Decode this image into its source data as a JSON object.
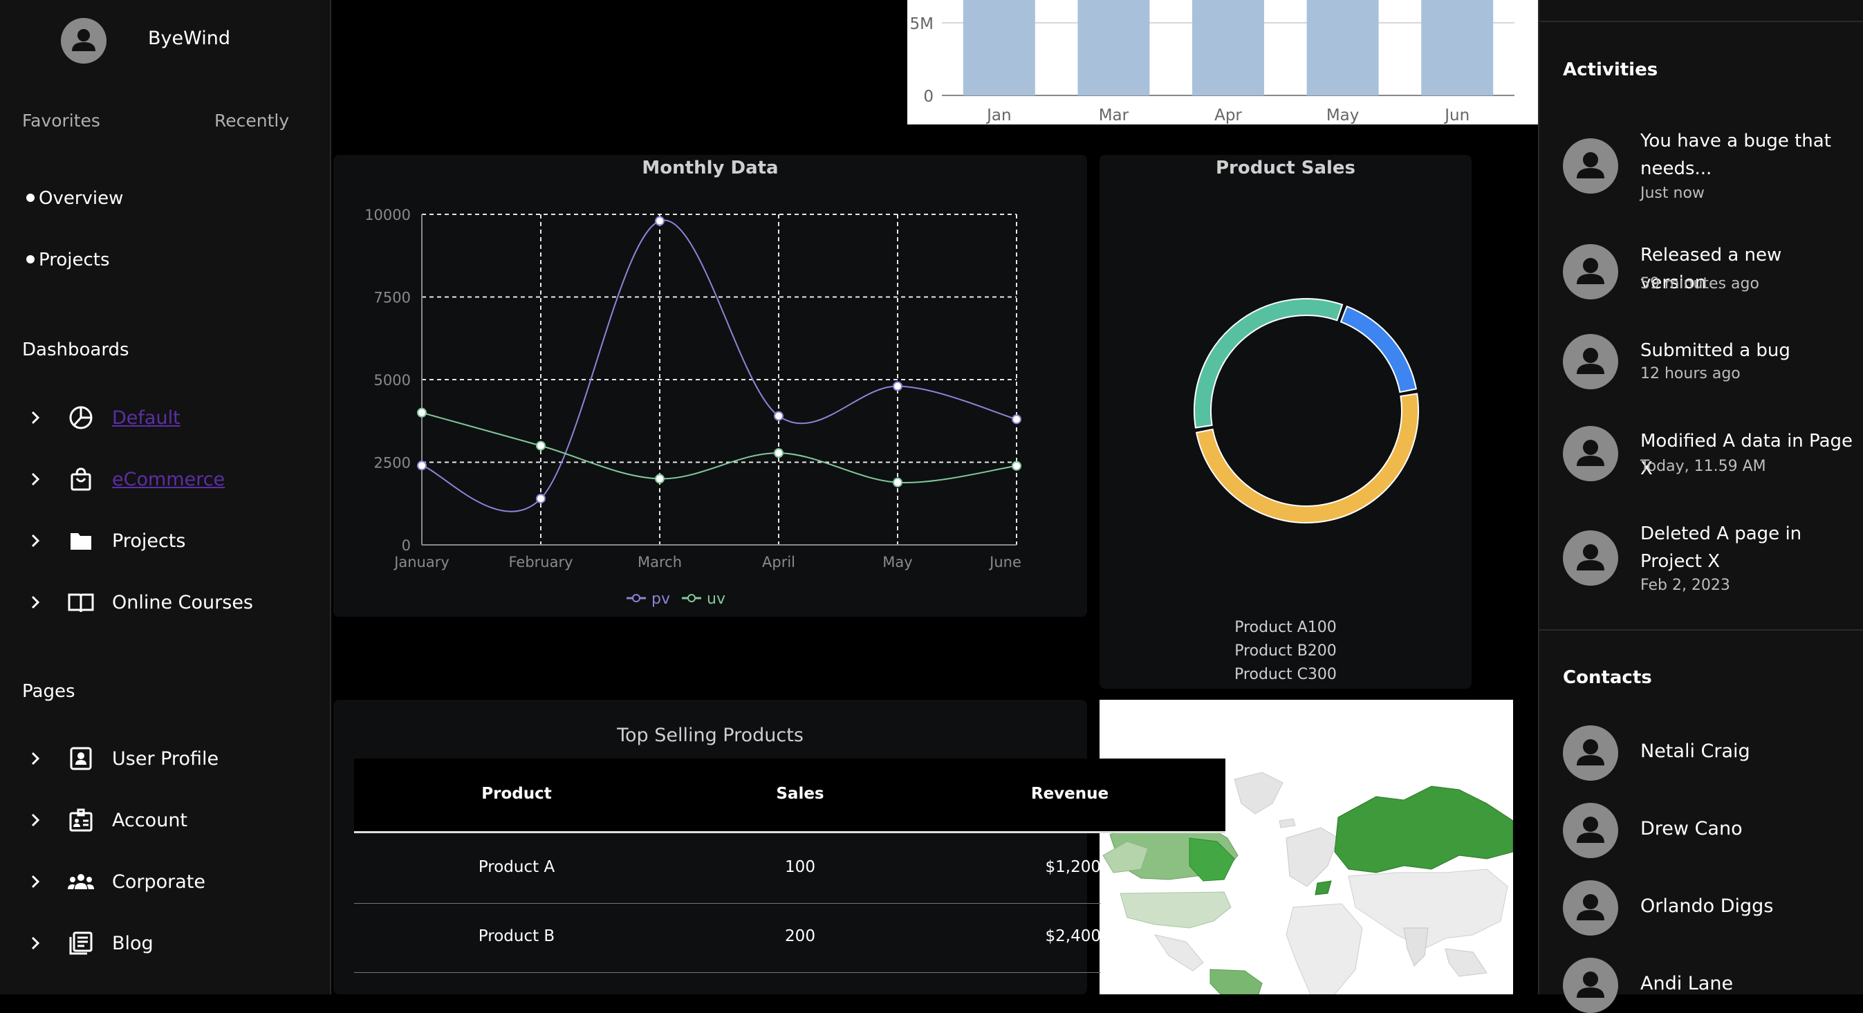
{
  "sidebar": {
    "brand": "ByeWind",
    "tabs": [
      "Favorites",
      "Recently"
    ],
    "quick_items": [
      "Overview",
      "Projects"
    ],
    "dashboards_label": "Dashboards",
    "dashboards": [
      {
        "label": "Default",
        "icon": "pie-chart-icon"
      },
      {
        "label": "eCommerce",
        "icon": "shopping-bag-icon"
      },
      {
        "label": "Projects",
        "icon": "folder-icon"
      },
      {
        "label": "Online Courses",
        "icon": "book-open-icon"
      }
    ],
    "pages_label": "Pages",
    "pages": [
      {
        "label": "User Profile",
        "icon": "user-profile-icon"
      },
      {
        "label": "Account",
        "icon": "id-card-icon"
      },
      {
        "label": "Corporate",
        "icon": "users-group-icon"
      },
      {
        "label": "Blog",
        "icon": "article-icon"
      }
    ]
  },
  "top_chart": {
    "chart_data": {
      "type": "bar",
      "categories": [
        "Jan",
        "Mar",
        "Apr",
        "May",
        "Jun"
      ],
      "y_ticks": [
        "0",
        "5M"
      ],
      "color": "#a9c0da",
      "note": "bars extend above visible area"
    }
  },
  "monthly": {
    "title": "Monthly Data",
    "chart_data": {
      "type": "line",
      "x": [
        "January",
        "February",
        "March",
        "April",
        "May",
        "June"
      ],
      "ylim": [
        0,
        10000
      ],
      "y_ticks": [
        0,
        2500,
        5000,
        7500,
        10000
      ],
      "grid": true,
      "legend": "bottom",
      "series": [
        {
          "name": "pv",
          "color": "#8d84d8",
          "values": [
            2400,
            1400,
            9800,
            3900,
            4800,
            3800
          ]
        },
        {
          "name": "uv",
          "color": "#82c99d",
          "values": [
            4000,
            3000,
            2000,
            2780,
            1890,
            2390
          ]
        }
      ]
    }
  },
  "sales": {
    "title": "Product Sales",
    "chart_data": {
      "type": "pie",
      "labels": [
        "Product A",
        "Product B",
        "Product C"
      ],
      "values": [
        100,
        200,
        300
      ],
      "colors": [
        "#3d85f0",
        "#57c0a0",
        "#f0b94c"
      ]
    },
    "legend": [
      "Product A100",
      "Product B200",
      "Product C300"
    ]
  },
  "top_products": {
    "title": "Top Selling Products",
    "headers": [
      "Product",
      "Sales",
      "Revenue"
    ],
    "rows": [
      {
        "product": "Product A",
        "sales": "100",
        "revenue": "$1,200"
      },
      {
        "product": "Product B",
        "sales": "200",
        "revenue": "$2,400"
      }
    ]
  },
  "activities": {
    "title": "Activities",
    "items": [
      {
        "text": "You have a buge that needs...",
        "time": "Just now"
      },
      {
        "text": "Released a new version",
        "time": "59 minutes ago"
      },
      {
        "text": "Submitted a bug",
        "time": "12 hours ago"
      },
      {
        "text": "Modified A data in Page X",
        "time": "Today, 11.59 AM"
      },
      {
        "text": "Deleted A page in Project X",
        "time": "Feb 2, 2023"
      }
    ]
  },
  "contacts": {
    "title": "Contacts",
    "items": [
      "Netali Craig",
      "Drew Cano",
      "Orlando Diggs",
      "Andi Lane"
    ]
  }
}
